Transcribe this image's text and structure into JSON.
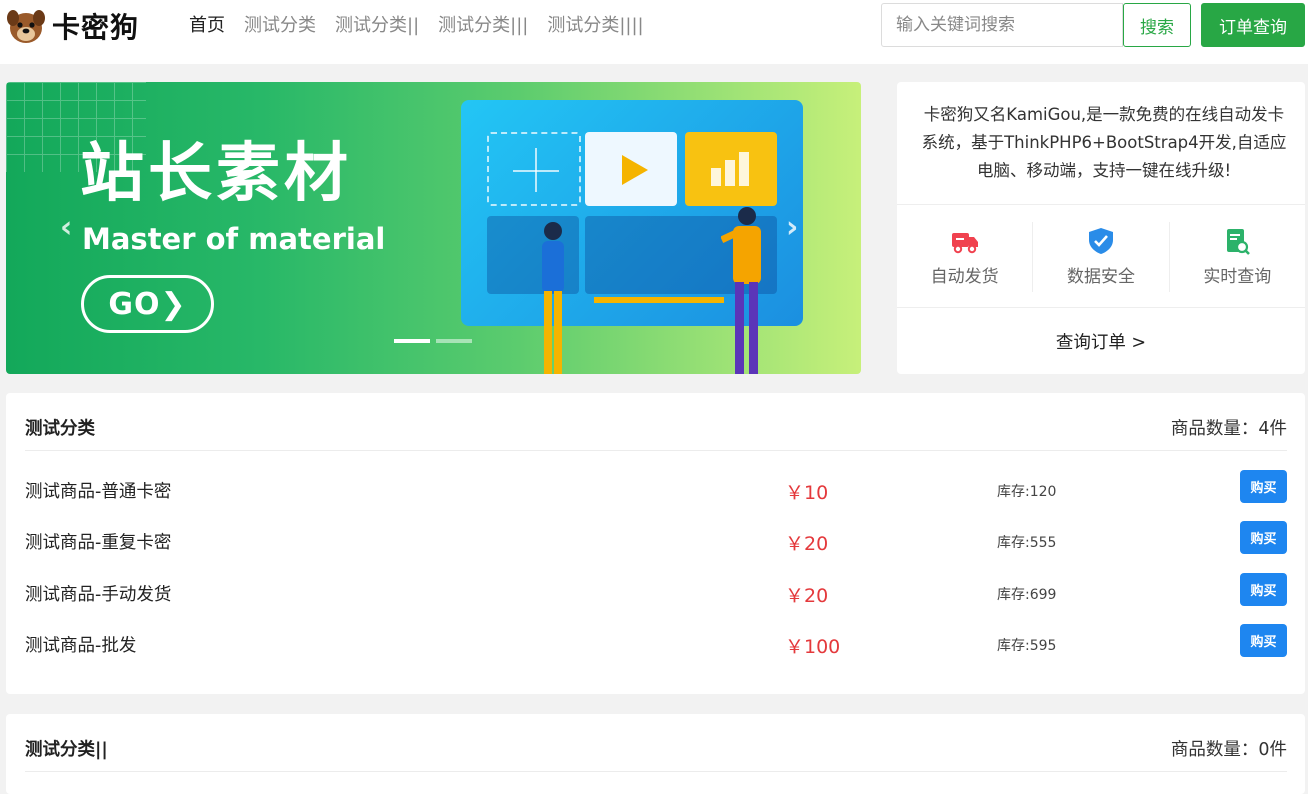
{
  "header": {
    "logo_text": "卡密狗",
    "nav": [
      {
        "label": "首页",
        "active": true
      },
      {
        "label": "测试分类",
        "active": false
      },
      {
        "label": "测试分类||",
        "active": false
      },
      {
        "label": "测试分类|||",
        "active": false
      },
      {
        "label": "测试分类||||",
        "active": false
      }
    ],
    "search_placeholder": "输入关键词搜索",
    "search_button": "搜索",
    "order_button": "订单查询"
  },
  "banner": {
    "title": "站长素材",
    "subtitle": "Master of material",
    "go_label": "GO",
    "go_arrow": "❯",
    "prev_arrow": "‹",
    "next_arrow": "›"
  },
  "info": {
    "description": "卡密狗又名KamiGou,是一款免费的在线自动发卡系统，基于ThinkPHP6+BootStrap4开发,自适应电脑、移动端，支持一键在线升级!",
    "features": [
      {
        "label": "自动发货",
        "icon": "delivery-truck-icon"
      },
      {
        "label": "数据安全",
        "icon": "shield-check-icon"
      },
      {
        "label": "实时查询",
        "icon": "document-search-icon"
      }
    ],
    "query_link": "查询订单 >"
  },
  "categories": [
    {
      "title": "测试分类",
      "count_label": "商品数量：4件",
      "products": [
        {
          "name": "测试商品-普通卡密",
          "price": "￥10",
          "stock": "库存:120",
          "buy": "购买"
        },
        {
          "name": "测试商品-重复卡密",
          "price": "￥20",
          "stock": "库存:555",
          "buy": "购买"
        },
        {
          "name": "测试商品-手动发货",
          "price": "￥20",
          "stock": "库存:699",
          "buy": "购买"
        },
        {
          "name": "测试商品-批发",
          "price": "￥100",
          "stock": "库存:595",
          "buy": "购买"
        }
      ]
    },
    {
      "title": "测试分类||",
      "count_label": "商品数量：0件",
      "products": []
    }
  ],
  "colors": {
    "primary_green": "#28a745",
    "price_red": "#e4393c",
    "buy_blue": "#1e86f0"
  }
}
